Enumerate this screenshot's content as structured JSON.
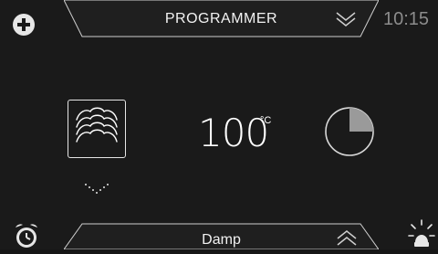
{
  "header": {
    "title": "PROGRAMMER",
    "time": "10:15",
    "add_icon": "plus-circle-icon",
    "expand_icon": "double-chevron-down-icon"
  },
  "main": {
    "mode_icon": "steam-clouds-icon",
    "mode_dropdown_icon": "dotted-chevron-down-icon",
    "temperature": {
      "value": "100",
      "unit": "°C"
    },
    "timer": {
      "icon": "timer-pie-icon",
      "progress_fraction": 0.25
    }
  },
  "footer": {
    "mode_label": "Damp",
    "alarm_icon": "alarm-clock-icon",
    "light_icon": "oven-light-icon",
    "collapse_icon": "double-chevron-up-icon"
  },
  "colors": {
    "background": "#1a1a1a",
    "tab_fill": "#d9d9d9",
    "text": "#ffffff",
    "muted": "#8c8c8c",
    "timer_fill": "#9a9a9a"
  }
}
